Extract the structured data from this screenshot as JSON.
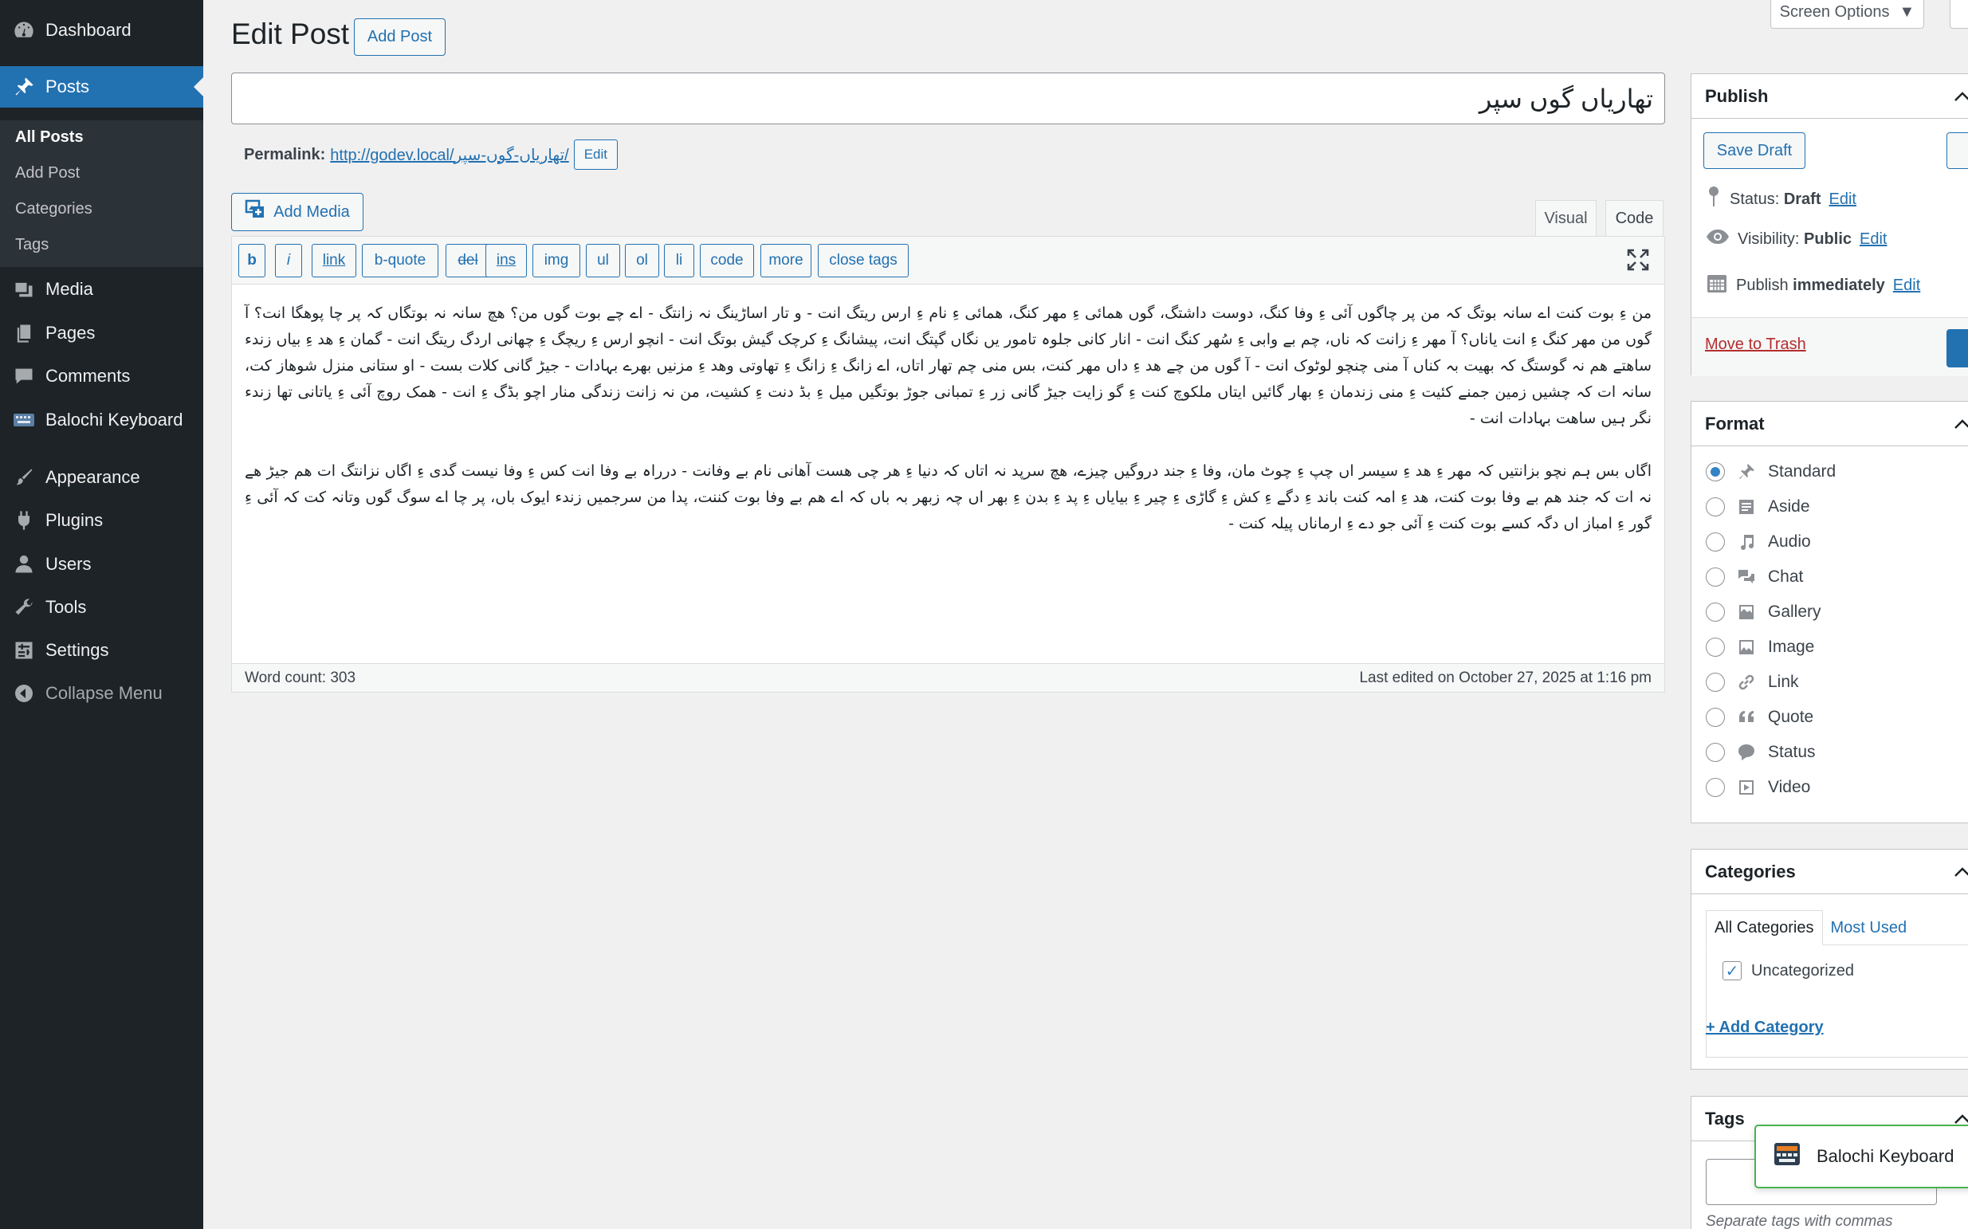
{
  "menu": {
    "dashboard": "Dashboard",
    "posts": "Posts",
    "posts_sub": [
      "All Posts",
      "Add Post",
      "Categories",
      "Tags"
    ],
    "media": "Media",
    "pages": "Pages",
    "comments": "Comments",
    "balochi_keyboard": "Balochi Keyboard",
    "appearance": "Appearance",
    "plugins": "Plugins",
    "users": "Users",
    "tools": "Tools",
    "settings": "Settings",
    "collapse": "Collapse Menu"
  },
  "header": {
    "title": "Edit Post",
    "add_post": "Add Post",
    "screen_options": "Screen Options"
  },
  "post": {
    "title": "تھاریاں گوں سپر",
    "permalink_label": "Permalink:",
    "permalink_url": "http://godev.local/تھاریاں-گوں-سپر/",
    "permalink_edit": "Edit"
  },
  "editor": {
    "add_media": "Add Media",
    "tab_visual": "Visual",
    "tab_code": "Code",
    "quicktags": [
      "b",
      "i",
      "link",
      "b-quote",
      "del",
      "ins",
      "img",
      "ul",
      "ol",
      "li",
      "code",
      "more",
      "close tags"
    ],
    "paragraph1": "من ءِ بوت کنت اے سانہ بوتگ کہ من پر چاگوں آئی ءِ وفا کنگ، دوست داشتگ، گوں ھمائی ءِ مھر کنگ، ھمائی ءِ نام ءِ ارس ریتگ انت - و تار اساڑینگ نہ زانتگ - اے چے بوت گوں من؟ ھچ سانہ نہ بوتگاں کہ پر چا پوھگا انت؟ آ گوں من مھر کنگ ءِ انت یاناں؟ آ مھر ءِ زانت کہ ناں، چم بے وابی ءِ سُھر کنگ انت - انار کانی جلوہ تامور یں نگاں گپتگ انت، پیشانگ ءِ کرچک گیش بوتگ انت - انچو ارس ءِ ریچگ ءِ چھانی اردگ ریتگ انت - گمان ءِ ھد ءِ بیاں زندء ساھتے ھم نہ گوستگ کہ بھیت بہ کناں آ منی چنچو لوٹوک انت - آ گوں من چے ھد ءِ داں مھر کنت، بس منی چم تھار اتاں، اے زانگ ءِ زانگ ءِ تھاوتی وھد ءِ مزنیں بھرے بہادات - جیڑ گانی کلات بست - او ستانی منزل شوھاز کت، سانہ ات کہ چشیں زمین جمنے کئیت ءِ منی زندمان ءِ بھار گائیں ایتاں ملکوچ کنت ءِ گو زایت جیڑ گانی زر ءِ تمبانی جوڑ بوتگیں میل ءِ بڈ دنت ءِ کشیت، من نہ زانت زندگی منار اچو بڈگ ءِ انت - ھمک روچ آئی ءِ یاتانی تھا زندء نگر ہیں ساھت بہادات انت -",
    "paragraph2": "اگاں بس ہم نچو بزانتیں کہ مھر ءِ ھد ءِ سیسر اں چپ ءِ چوٹ مان، وفا ءِ جند دروگیں چیزے، ھچ سرپد نہ اتاں کہ دنیا ءِ ھر چی ھست آھانی نام بے وفانت - درراہ بے وفا انت کس ءِ وفا نیست گدی ءِ اگاں نزانتگ ات ھم جیڑ ھے نہ ات کہ جند ھم بے وفا بوت کنت، ھد ءِ امہ کنت باند ءِ دگے ءِ کش ءِ گاڑی ءِ چیر ءِ بیایاں ءِ پد ءِ بدن ءِ بھر اں چہ زبھر بہ باں کہ اے ھم بے وفا بوت کننت، پدا من سرجمیں زندء ایوک باں، پر چا اے سوگ گوں وتانہ کت کہ آئی ءِ گور ءِ امباز اں دگہ کسے بوت کنت ءِ آئی جو دے ءِ ارماناں پیلہ کنت -",
    "word_count": "Word count: 303",
    "last_edited": "Last edited on October 27, 2025 at 1:16 pm"
  },
  "publish": {
    "heading": "Publish",
    "save_draft": "Save Draft",
    "status_label": "Status:",
    "status_value": "Draft",
    "visibility_label": "Visibility:",
    "visibility_value": "Public",
    "publish_label": "Publish",
    "publish_value": "immediately",
    "edit": "Edit",
    "move_to_trash": "Move to Trash"
  },
  "format": {
    "heading": "Format",
    "options": [
      "Standard",
      "Aside",
      "Audio",
      "Chat",
      "Gallery",
      "Image",
      "Link",
      "Quote",
      "Status",
      "Video"
    ],
    "selected": "Standard"
  },
  "categories": {
    "heading": "Categories",
    "tab_all": "All Categories",
    "tab_most_used": "Most Used",
    "items": [
      "Uncategorized"
    ],
    "add_new": "+ Add Category"
  },
  "tags": {
    "heading": "Tags",
    "hint": "Separate tags with commas"
  },
  "toast": {
    "label": "Balochi Keyboard"
  },
  "colors": {
    "sidebar_bg": "#1d2327",
    "accent": "#2271b1",
    "trash": "#b32d2e",
    "toast_border": "#46b450"
  }
}
